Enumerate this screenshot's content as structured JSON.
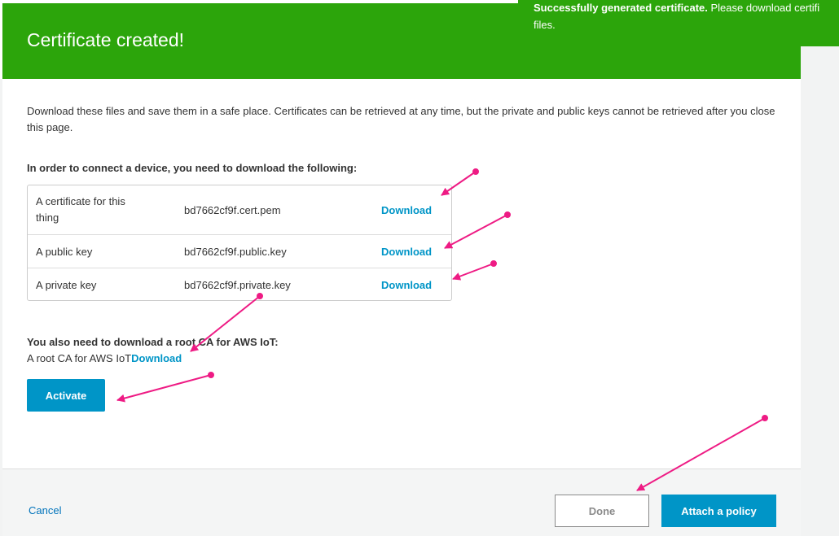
{
  "header": {
    "title": "Certificate created!"
  },
  "toast": {
    "strong": "Successfully generated certificate.",
    "rest": " Please download certifi",
    "line2": "files."
  },
  "intro": "Download these files and save them in a safe place. Certificates can be retrieved at any time, but the private and public keys cannot be retrieved after you close this page.",
  "subhead": "In order to connect a device, you need to download the following:",
  "files": [
    {
      "desc": "A certificate for this thing",
      "name": "bd7662cf9f.cert.pem",
      "link": "Download"
    },
    {
      "desc": "A public key",
      "name": "bd7662cf9f.public.key",
      "link": "Download"
    },
    {
      "desc": "A private key",
      "name": "bd7662cf9f.private.key",
      "link": "Download"
    }
  ],
  "root_ca": {
    "heading": "You also need to download a root CA for AWS IoT:",
    "label": "A root CA for AWS IoT",
    "link": "Download"
  },
  "activate_label": "Activate",
  "footer": {
    "cancel": "Cancel",
    "done": "Done",
    "attach": "Attach a policy"
  },
  "colors": {
    "header_green": "#2ca50b",
    "primary_blue": "#0095c7",
    "annotation_pink": "#ee1b84"
  }
}
